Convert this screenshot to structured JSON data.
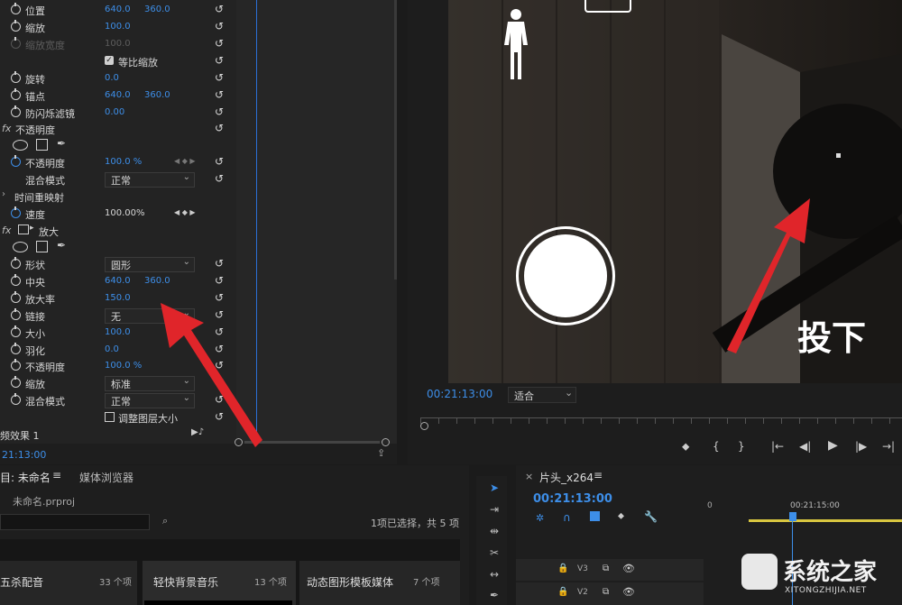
{
  "effect_controls": {
    "rows": [
      {
        "label": "位置",
        "v1": "640.0",
        "v2": "360.0"
      },
      {
        "label": "缩放",
        "v1": "100.0",
        "v2": ""
      },
      {
        "label": "缩放宽度",
        "v1": "100.0",
        "v2": "",
        "dim": true
      },
      {
        "label": "等比缩放"
      },
      {
        "label": "旋转",
        "v1": "0.0",
        "v2": ""
      },
      {
        "label": "锚点",
        "v1": "640.0",
        "v2": "360.0"
      },
      {
        "label": "防闪烁滤镜",
        "v1": "0.00",
        "v2": ""
      }
    ],
    "opacity_section": "不透明度",
    "opacity_label": "不透明度",
    "opacity_value": "100.0 %",
    "blend_label": "混合模式",
    "blend_value": "正常",
    "time_remap_section": "时间重映射",
    "speed_label": "速度",
    "speed_value": "100.00%",
    "magnify_section": "放大",
    "shape_label": "形状",
    "shape_value": "圆形",
    "center_label": "中央",
    "center_v1": "640.0",
    "center_v2": "360.0",
    "magnification_label": "放大率",
    "magnification_value": "150.0",
    "link_label": "链接",
    "link_value": "无",
    "size_label": "大小",
    "size_value": "100.0",
    "feather_label": "羽化",
    "feather_value": "0.0",
    "opacity2_label": "不透明度",
    "opacity2_value": "100.0 %",
    "scaling_label": "缩放",
    "scaling_value": "标准",
    "blend2_label": "混合模式",
    "blend2_value": "正常",
    "adjust_layer_label": "调整图层大小",
    "audio_effect_label": "频效果 1",
    "timecode": "21:13:00",
    "fx": "fx"
  },
  "monitor": {
    "overlay_text": "投下",
    "timecode": "00:21:13:00",
    "fit_value": "适合",
    "chevron": "⌄",
    "buttons": [
      "⬥",
      "{",
      "}",
      "|←",
      "◀|",
      "▶",
      "|▶",
      "→|"
    ]
  },
  "project": {
    "tab_label": "目: 未命名",
    "menu_icon": "≡",
    "tab2_label": "媒体浏览器",
    "file_name": "未命名.prproj",
    "selection_status": "1项已选择，共 5 项",
    "bins": [
      {
        "name": "五杀配音",
        "count": "33 个项"
      },
      {
        "name": "轻快背景音乐",
        "count": "13 个项"
      },
      {
        "name": "动态图形模板媒体",
        "count": "7 个项"
      }
    ]
  },
  "timeline": {
    "close": "×",
    "sequence_name": "片头_x264",
    "menu_icon": "≡",
    "timecode": "00:21:13:00",
    "ruler_start": "0",
    "ruler_mark": "00:21:15:00",
    "tracks": [
      "V3",
      "V2"
    ]
  },
  "watermark": {
    "brand": "系统之家",
    "url": "XITONGZHIJIA.NET"
  },
  "colors": {
    "accent": "#3d8ee8",
    "arrow": "#e0252a",
    "panel": "#232323"
  }
}
